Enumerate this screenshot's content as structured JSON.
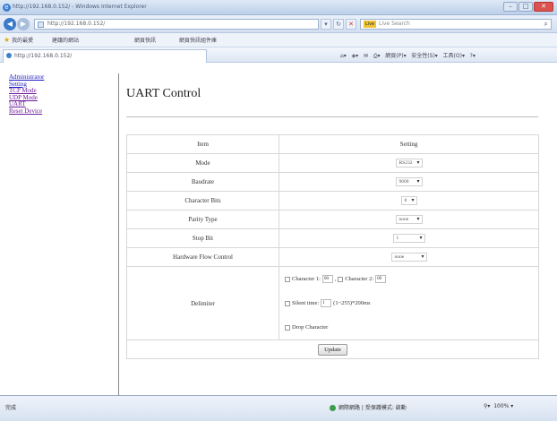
{
  "window": {
    "title": "http://192.168.0.152/ - Windows Internet Explorer",
    "controls": {
      "minimize": "–",
      "maximize": "□",
      "close": "✕"
    }
  },
  "addressbar": {
    "url": "http://192.168.0.152/",
    "search_placeholder": "Live Search",
    "search_engine": "Live"
  },
  "favorites": {
    "favorites_label": "我的最愛",
    "items": [
      "建議的網站",
      "網頁快訊",
      "網頁快訊組件庫"
    ]
  },
  "tab": {
    "label": "http://192.168.0.152/"
  },
  "commandbar": {
    "page": "網頁(P)",
    "safety": "安全性(S)",
    "tools": "工具(O)",
    "help": "?"
  },
  "sidebar": {
    "items": [
      {
        "label": "Administrator"
      },
      {
        "label": "Setting"
      },
      {
        "label": "TCP Mode"
      },
      {
        "label": "UDP Mode"
      },
      {
        "label": "UART"
      },
      {
        "label": "Reset Device"
      }
    ]
  },
  "page": {
    "title": "UART Control"
  },
  "table": {
    "header_item": "Item",
    "header_setting": "Setting",
    "rows": [
      {
        "label": "Mode",
        "value": "RS232"
      },
      {
        "label": "Baudrate",
        "value": "9600"
      },
      {
        "label": "Character Bits",
        "value": "8"
      },
      {
        "label": "Parity Type",
        "value": "none"
      },
      {
        "label": "Stop Bit",
        "value": "1"
      },
      {
        "label": "Hardware Flow Control",
        "value": "none"
      }
    ],
    "delimiter_label": "Delimiter",
    "char1_label": "Character 1:",
    "char1_value": "00",
    "char2_label": "Character 2:",
    "char2_value": "00",
    "silent_label": "Silent time:",
    "silent_value": "1",
    "silent_suffix": "(1~255)*200ms",
    "drop_label": "Drop Character",
    "update_button": "Update"
  },
  "statusbar": {
    "left": "完成",
    "zone": "網際網路 | 受保護模式: 啟動",
    "zoom": "100%"
  }
}
